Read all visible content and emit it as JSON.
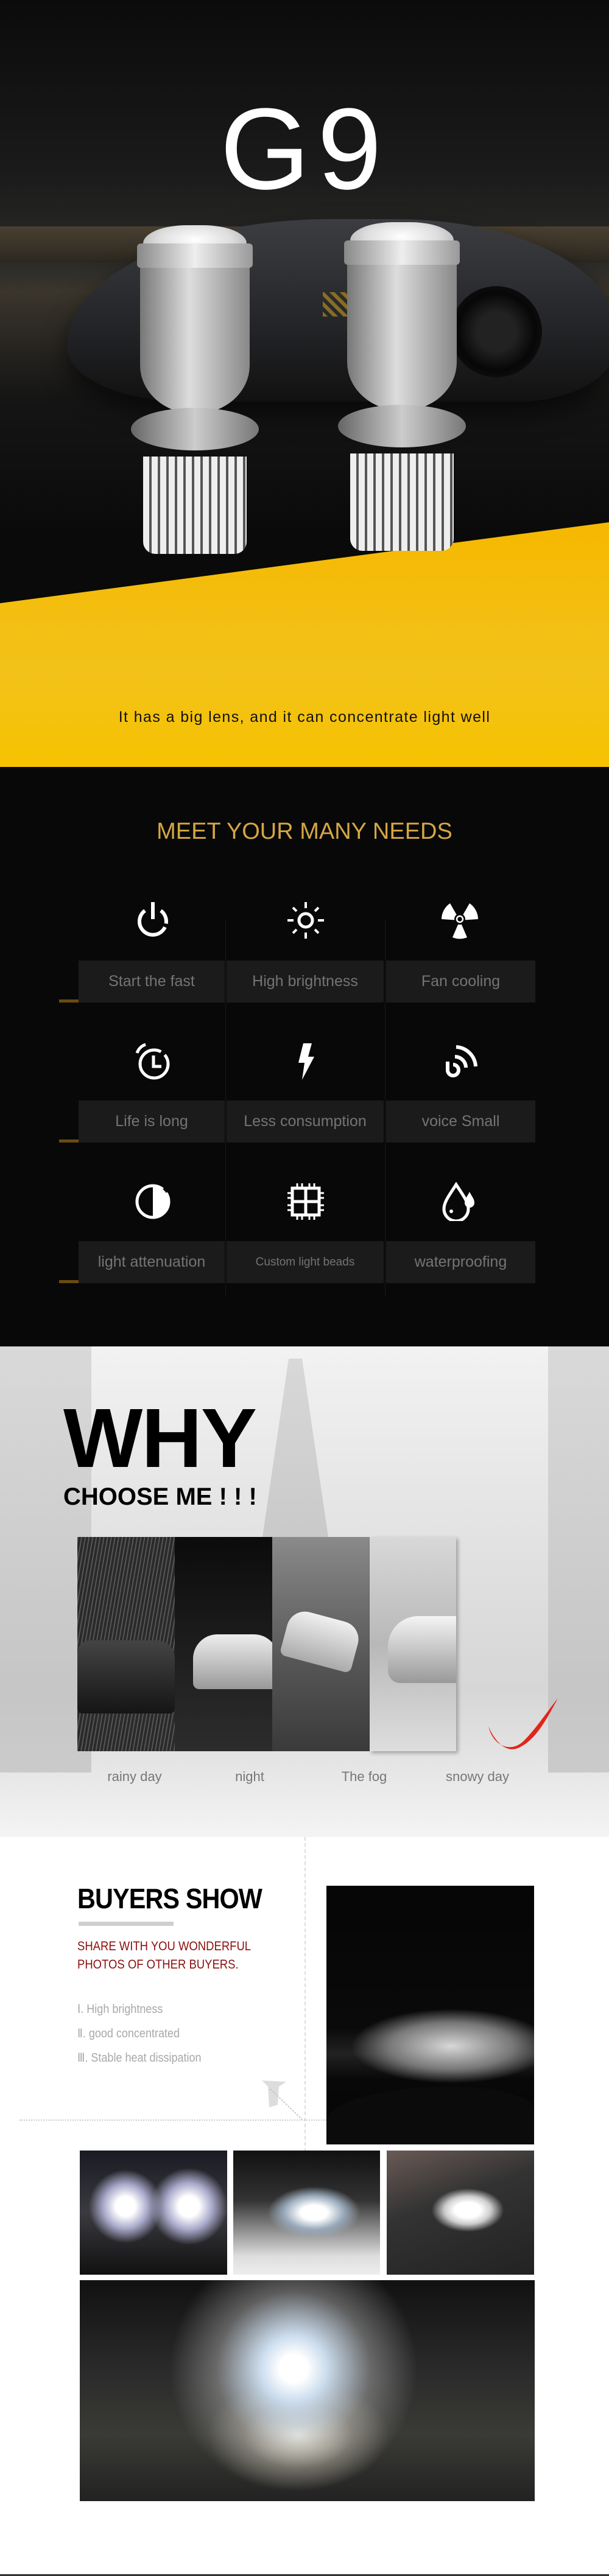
{
  "hero": {
    "title": "G9",
    "caption": "It has a big lens, and it can concentrate light well",
    "accent_color": "#f6b800"
  },
  "features": {
    "title": "MEET YOUR MANY NEEDS",
    "title_color": "#d4a645",
    "items": [
      {
        "label": "Start the fast",
        "icon": "power-icon"
      },
      {
        "label": "High brightness",
        "icon": "sun-icon"
      },
      {
        "label": "Fan cooling",
        "icon": "fan-icon"
      },
      {
        "label": "Life is long",
        "icon": "alarm-clock-icon"
      },
      {
        "label": "Less consumption",
        "icon": "lightning-icon"
      },
      {
        "label": "voice Small",
        "icon": "sound-waves-icon"
      },
      {
        "label": "light attenuation",
        "icon": "half-circle-icon"
      },
      {
        "label": "Custom light beads",
        "icon": "chip-icon"
      },
      {
        "label": "waterproofing",
        "icon": "water-drop-icon"
      }
    ]
  },
  "why": {
    "title": "WHY",
    "subtitle": "CHOOSE ME ! ! !",
    "scenes": [
      "rainy day",
      "night",
      "The fog",
      "snowy day"
    ]
  },
  "buyers": {
    "title": "BUYERS SHOW",
    "subtitle_lines": [
      "SHARE WITH YOU WONDERFUL",
      "PHOTOS OF OTHER BUYERS."
    ],
    "points": [
      "Ⅰ. High brightness",
      "Ⅱ. good concentrated",
      "Ⅲ. Stable heat dissipation"
    ],
    "subtitle_color": "#8b0f0f"
  }
}
